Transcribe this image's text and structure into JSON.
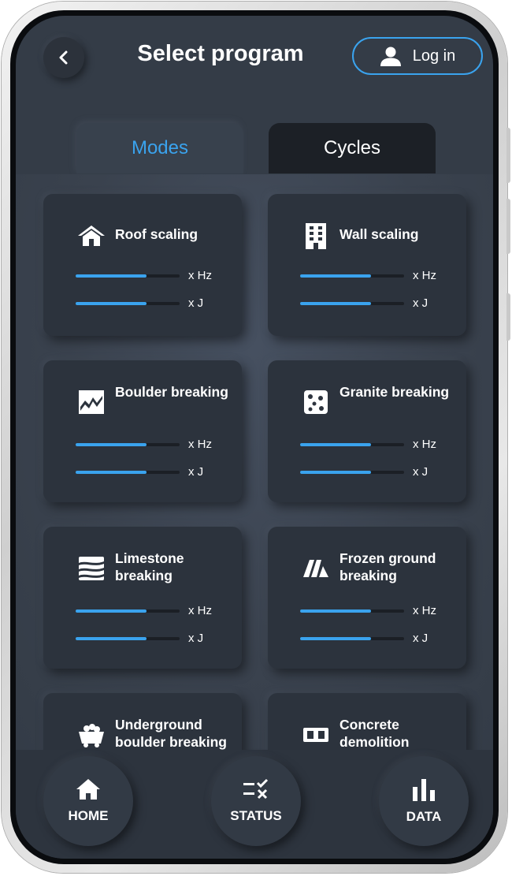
{
  "header": {
    "title": "Select program",
    "login_label": "Log in"
  },
  "tabs": [
    {
      "label": "Modes",
      "active": true
    },
    {
      "label": "Cycles",
      "active": false
    }
  ],
  "cards": [
    {
      "name": "Roof scaling",
      "icon": "house-icon",
      "hz_label": "x Hz",
      "j_label": "x J",
      "hz_level": 0.68,
      "j_level": 0.68
    },
    {
      "name": "Wall scaling",
      "icon": "building-icon",
      "hz_label": "x Hz",
      "j_label": "x J",
      "hz_level": 0.68,
      "j_level": 0.68
    },
    {
      "name": "Boulder breaking",
      "icon": "boulder-icon",
      "hz_label": "x Hz",
      "j_label": "x J",
      "hz_level": 0.68,
      "j_level": 0.68
    },
    {
      "name": "Granite breaking",
      "icon": "dice-icon",
      "hz_label": "x Hz",
      "j_label": "x J",
      "hz_level": 0.68,
      "j_level": 0.68
    },
    {
      "name": "Limestone breaking",
      "icon": "layers-icon",
      "hz_label": "x Hz",
      "j_label": "x J",
      "hz_level": 0.68,
      "j_level": 0.68
    },
    {
      "name": "Frozen ground breaking",
      "icon": "ice-icon",
      "hz_label": "x Hz",
      "j_label": "x J",
      "hz_level": 0.68,
      "j_level": 0.68
    },
    {
      "name": "Underground boulder breaking",
      "icon": "mine-cart-icon"
    },
    {
      "name": "Concrete demolition",
      "icon": "concrete-icon"
    }
  ],
  "nav": [
    {
      "label": "HOME",
      "icon": "home-icon"
    },
    {
      "label": "STATUS",
      "icon": "status-icon"
    },
    {
      "label": "DATA",
      "icon": "bar-chart-icon"
    }
  ],
  "colors": {
    "accent": "#3aa3ee",
    "background": "#343c47",
    "card": "#2c333d"
  }
}
